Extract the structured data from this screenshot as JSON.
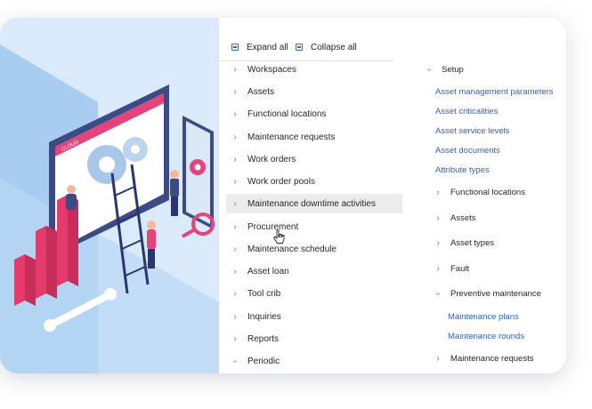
{
  "toolbar": {
    "expand_all": "Expand all",
    "collapse_all": "Collapse all"
  },
  "modules": [
    {
      "label": "Workspaces",
      "state": "collapsed"
    },
    {
      "label": "Assets",
      "state": "collapsed"
    },
    {
      "label": "Functional locations",
      "state": "collapsed"
    },
    {
      "label": "Maintenance requests",
      "state": "collapsed"
    },
    {
      "label": "Work orders",
      "state": "collapsed"
    },
    {
      "label": "Work order pools",
      "state": "collapsed"
    },
    {
      "label": "Maintenance downtime activities",
      "state": "collapsed",
      "hovered": true
    },
    {
      "label": "Procurement",
      "state": "collapsed"
    },
    {
      "label": "Maintenance schedule",
      "state": "collapsed"
    },
    {
      "label": "Asset loan",
      "state": "collapsed"
    },
    {
      "label": "Tool crib",
      "state": "collapsed"
    },
    {
      "label": "Inquiries",
      "state": "collapsed"
    },
    {
      "label": "Reports",
      "state": "collapsed"
    },
    {
      "label": "Periodic",
      "state": "expanded"
    }
  ],
  "setup": {
    "title": "Setup",
    "links": [
      "Asset management parameters",
      "Asset criticalities",
      "Asset service levels",
      "Asset documents",
      "Attribute types"
    ],
    "groups": [
      {
        "label": "Functional locations",
        "state": "collapsed"
      },
      {
        "label": "Assets",
        "state": "collapsed"
      },
      {
        "label": "Asset types",
        "state": "collapsed"
      },
      {
        "label": "Fault",
        "state": "collapsed"
      },
      {
        "label": "Preventive maintenance",
        "state": "expanded",
        "links": [
          "Maintenance plans",
          "Maintenance rounds"
        ]
      },
      {
        "label": "Maintenance requests",
        "state": "collapsed"
      }
    ]
  },
  "illustration": {
    "screen_label": "CLOUD"
  },
  "colors": {
    "accent": "#2f5fbd",
    "illustration_bg": "#dbeafb",
    "chart_bars": "#e23a6b",
    "hover": "#ececec"
  }
}
